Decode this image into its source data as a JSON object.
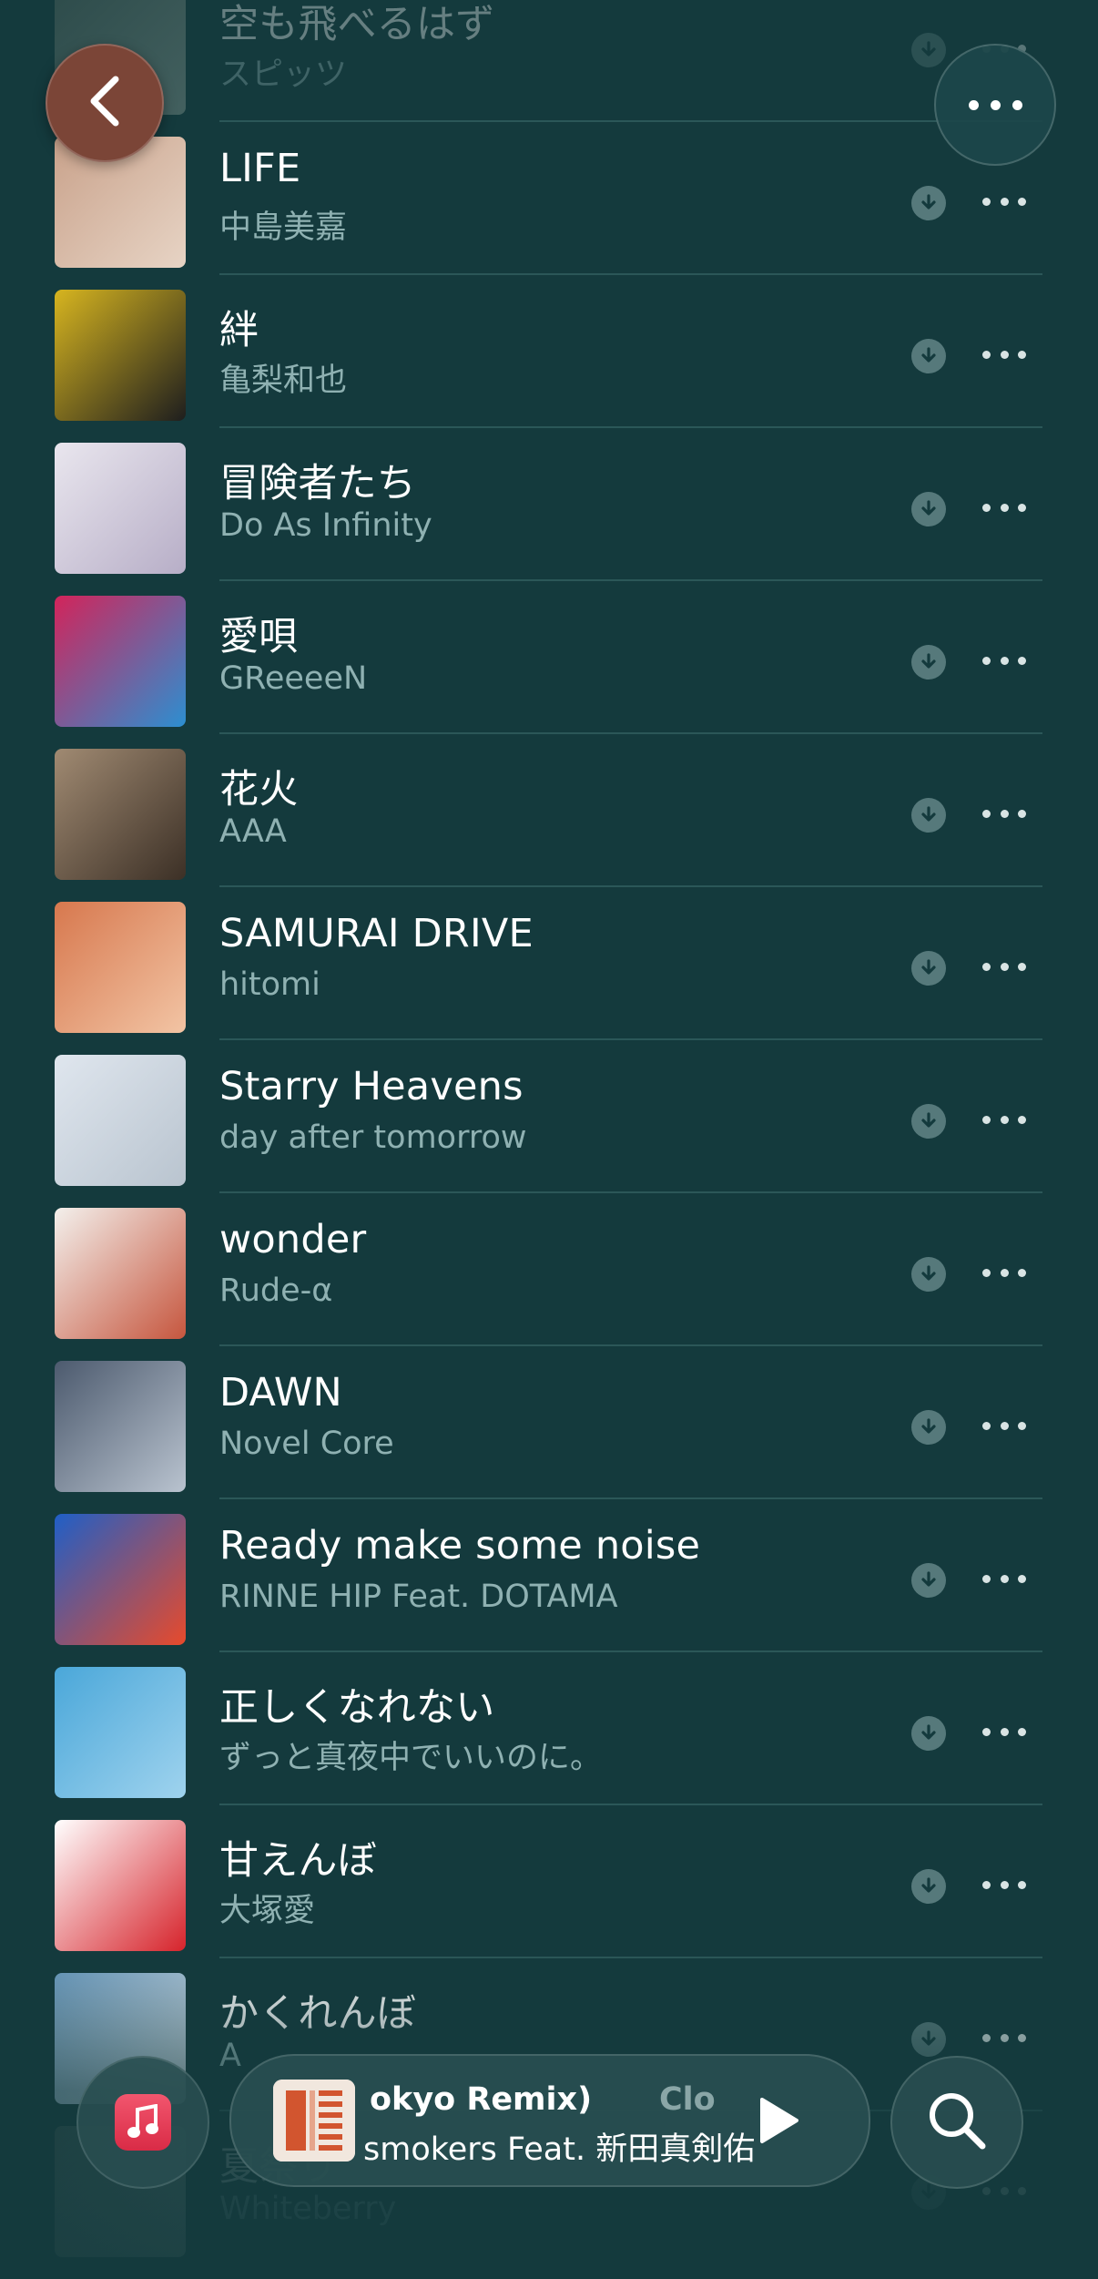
{
  "nav": {
    "back_icon": "chevron-left-icon",
    "more_icon": "ellipsis-icon"
  },
  "songs": [
    {
      "title": "空も飛べるはず",
      "artist": "スピッツ",
      "art_colors": [
        "#5b6b63",
        "#9aa79e"
      ]
    },
    {
      "title": "LIFE",
      "artist": "中島美嘉",
      "art_colors": [
        "#c9a28b",
        "#e7d4c5"
      ]
    },
    {
      "title": "絆",
      "artist": "亀梨和也",
      "art_colors": [
        "#d7b51f",
        "#1e1e1e"
      ]
    },
    {
      "title": "冒険者たち",
      "artist": "Do As Infinity",
      "art_colors": [
        "#e9e6ee",
        "#b7aec7"
      ]
    },
    {
      "title": "愛唄",
      "artist": "GReeeeN",
      "art_colors": [
        "#d2245a",
        "#2c8fd1"
      ]
    },
    {
      "title": "花火",
      "artist": "AAA",
      "art_colors": [
        "#a08a72",
        "#3c3026"
      ]
    },
    {
      "title": "SAMURAI DRIVE",
      "artist": "hitomi",
      "art_colors": [
        "#d7784e",
        "#f2c4a4"
      ]
    },
    {
      "title": "Starry Heavens",
      "artist": "day after tomorrow",
      "art_colors": [
        "#dfe6ee",
        "#b9c4cf"
      ]
    },
    {
      "title": "wonder",
      "artist": "Rude-α",
      "art_colors": [
        "#f3f0ec",
        "#c6563e"
      ]
    },
    {
      "title": "DAWN",
      "artist": "Novel Core",
      "art_colors": [
        "#4c5a6e",
        "#b9c3cf"
      ]
    },
    {
      "title": "Ready make some noise",
      "artist": "RINNE HIP Feat. DOTAMA",
      "art_colors": [
        "#1f5fc7",
        "#e84a2b"
      ]
    },
    {
      "title": "正しくなれない",
      "artist": "ずっと真夜中でいいのに。",
      "art_colors": [
        "#4aa7d9",
        "#9fd3ee"
      ]
    },
    {
      "title": "甘えんぼ",
      "artist": "大塚愛",
      "art_colors": [
        "#ffffff",
        "#d6232b"
      ]
    },
    {
      "title": "かくれんぼ",
      "artist": "A",
      "art_colors": [
        "#6f9fc4",
        "#dfe7ee"
      ]
    },
    {
      "title": "夏祭り",
      "artist": "Whiteberry",
      "art_colors": [
        "#6f7a74",
        "#c2c8c4"
      ]
    }
  ],
  "row_download_icon": "download-icon",
  "row_more_icon": "ellipsis-icon",
  "player": {
    "title_visible": "okyo Remix)",
    "title_next_visible": "Clo",
    "artist_visible": "smokers Feat. 新田真剣佑",
    "play_icon": "play-icon",
    "library_icon": "music-note-icon",
    "search_icon": "search-icon"
  },
  "colors": {
    "background": "#143a3d",
    "title": "#ffffff",
    "artist": "#8fb1b2",
    "accent_red": "#e63a55"
  }
}
